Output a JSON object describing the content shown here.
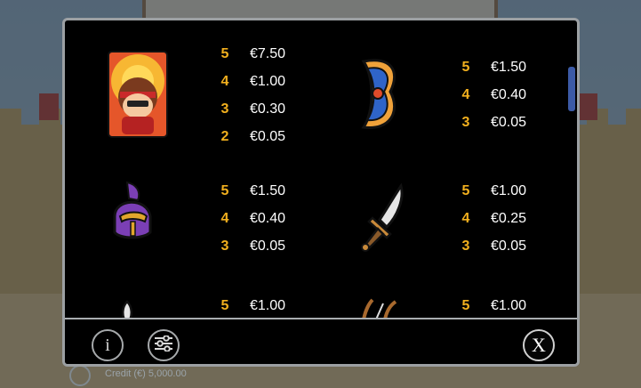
{
  "background": {
    "credit_text": "Credit (€) 5,000.00"
  },
  "paytable": {
    "symbols": [
      {
        "name": "warrior-card",
        "pays": [
          {
            "count": "5",
            "value": "€7.50"
          },
          {
            "count": "4",
            "value": "€1.00"
          },
          {
            "count": "3",
            "value": "€0.30"
          },
          {
            "count": "2",
            "value": "€0.05"
          }
        ]
      },
      {
        "name": "shield",
        "pays": [
          {
            "count": "5",
            "value": "€1.50"
          },
          {
            "count": "4",
            "value": "€0.40"
          },
          {
            "count": "3",
            "value": "€0.05"
          }
        ]
      },
      {
        "name": "helmet",
        "pays": [
          {
            "count": "5",
            "value": "€1.50"
          },
          {
            "count": "4",
            "value": "€0.40"
          },
          {
            "count": "3",
            "value": "€0.05"
          }
        ]
      },
      {
        "name": "sword",
        "pays": [
          {
            "count": "5",
            "value": "€1.00"
          },
          {
            "count": "4",
            "value": "€0.25"
          },
          {
            "count": "3",
            "value": "€0.05"
          }
        ]
      },
      {
        "name": "dagger",
        "pays": [
          {
            "count": "5",
            "value": "€1.00"
          }
        ]
      },
      {
        "name": "bow",
        "pays": [
          {
            "count": "5",
            "value": "€1.00"
          }
        ]
      }
    ]
  },
  "controls": {
    "info_label": "i",
    "close_label": "X",
    "info_icon": "info-icon",
    "settings_icon": "sliders-icon",
    "close_icon": "close-icon"
  },
  "colors": {
    "count": "#f2b01e",
    "value": "#ffffff",
    "panel_bg": "#000000",
    "scroll_thumb": "#3c5aa6"
  }
}
